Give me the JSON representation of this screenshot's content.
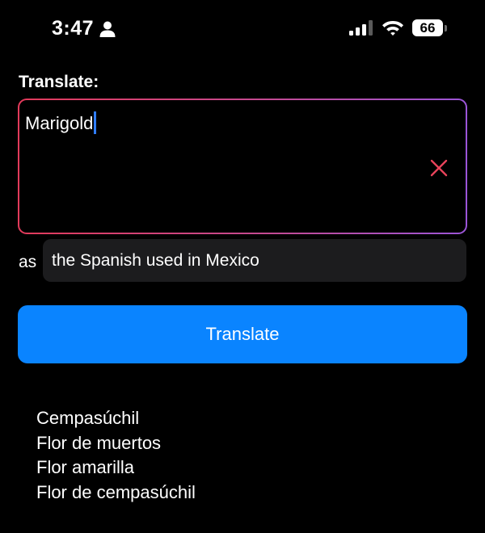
{
  "status_bar": {
    "time": "3:47",
    "battery_level": "66",
    "icons": [
      "person-icon",
      "cellular-signal-icon",
      "wifi-icon",
      "battery-icon"
    ]
  },
  "translate_section": {
    "label": "Translate:",
    "input_value": "Marigold",
    "clear_icon": "close-icon",
    "accent_colors": [
      "#e23a5a",
      "#9b55d8"
    ]
  },
  "target_language": {
    "prefix": "as",
    "value": "the Spanish used in Mexico"
  },
  "action": {
    "button_label": "Translate",
    "button_color": "#0a84ff"
  },
  "results": [
    "Cempasúchil",
    "Flor de muertos",
    "Flor amarilla",
    "Flor de cempasúchil"
  ]
}
